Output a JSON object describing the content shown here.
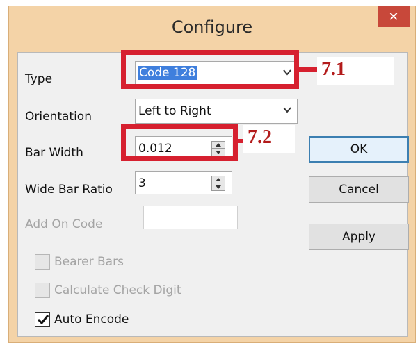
{
  "window": {
    "title": "Configure",
    "close_glyph": "✕",
    "colors": {
      "frame": "#f4d3a7",
      "close": "#c8483a",
      "client": "#f0f0f0",
      "annotation": "#d6202f"
    }
  },
  "form": {
    "type": {
      "label": "Type",
      "value": "Code 128"
    },
    "orientation": {
      "label": "Orientation",
      "value": "Left to Right"
    },
    "bar_width": {
      "label": "Bar Width",
      "value": "0.012"
    },
    "wide_bar_ratio": {
      "label": "Wide Bar Ratio",
      "value": "3"
    },
    "add_on_code": {
      "label": "Add On Code",
      "value": ""
    }
  },
  "checkboxes": [
    {
      "label": "Bearer Bars",
      "checked": false,
      "enabled": false
    },
    {
      "label": "Calculate Check Digit",
      "checked": false,
      "enabled": false
    },
    {
      "label": "Auto Encode",
      "checked": true,
      "enabled": true
    }
  ],
  "buttons": {
    "ok": "OK",
    "cancel": "Cancel",
    "apply": "Apply"
  },
  "annotations": [
    {
      "label": "7.1"
    },
    {
      "label": "7.2"
    }
  ],
  "icons": {
    "dropdown": "chevron-down-icon",
    "spinner": "spinner-arrows-icon",
    "check": "checkmark-icon",
    "close": "close-icon"
  }
}
